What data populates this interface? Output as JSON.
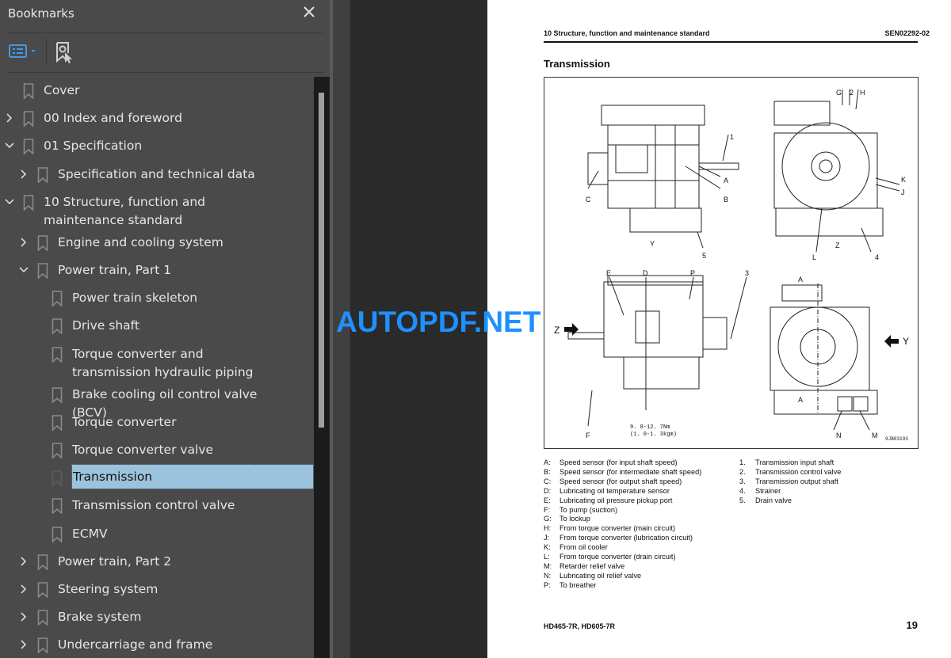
{
  "sidebar": {
    "title": "Bookmarks",
    "close_icon": "close-icon",
    "toolbar": {
      "options_icon": "bookmark-options-icon",
      "dropdown_icon": "caret-down-icon",
      "find_icon": "find-current-bookmark-icon"
    },
    "items": [
      {
        "label": "Cover",
        "level": 0,
        "expander": "none"
      },
      {
        "label": "00 Index and foreword",
        "level": 0,
        "expander": "collapsed"
      },
      {
        "label": "01 Specification",
        "level": 0,
        "expander": "expanded"
      },
      {
        "label": "Specification and technical data",
        "level": 1,
        "expander": "collapsed"
      },
      {
        "label": "10 Structure, function and maintenance standard",
        "level": 0,
        "expander": "expanded"
      },
      {
        "label": "Engine and cooling system",
        "level": 1,
        "expander": "collapsed"
      },
      {
        "label": "Power train, Part 1",
        "level": 1,
        "expander": "expanded"
      },
      {
        "label": "Power train skeleton",
        "level": 2,
        "expander": "none"
      },
      {
        "label": "Drive shaft",
        "level": 2,
        "expander": "none"
      },
      {
        "label": "Torque converter and transmission hydraulic piping",
        "level": 2,
        "expander": "none"
      },
      {
        "label": "Brake cooling oil control valve (BCV)",
        "level": 2,
        "expander": "none"
      },
      {
        "label": "Torque converter",
        "level": 2,
        "expander": "none"
      },
      {
        "label": "Torque converter valve",
        "level": 2,
        "expander": "none"
      },
      {
        "label": "Transmission",
        "level": 2,
        "expander": "none",
        "selected": true
      },
      {
        "label": "Transmission control valve",
        "level": 2,
        "expander": "none"
      },
      {
        "label": "ECMV",
        "level": 2,
        "expander": "none"
      },
      {
        "label": "Power train, Part 2",
        "level": 1,
        "expander": "collapsed"
      },
      {
        "label": "Steering system",
        "level": 1,
        "expander": "collapsed"
      },
      {
        "label": "Brake system",
        "level": 1,
        "expander": "collapsed"
      },
      {
        "label": "Undercarriage and frame",
        "level": 1,
        "expander": "collapsed"
      }
    ]
  },
  "watermark": "AUTOPDF.NET",
  "page": {
    "header_left": "10 Structure, function and maintenance standard",
    "header_right": "SEN02292-02",
    "title": "Transmission",
    "figure": {
      "callouts_top_left": [
        "1",
        "A",
        "B",
        "C",
        "5",
        "Y"
      ],
      "callouts_top_right": [
        "G",
        "2",
        "H",
        "K",
        "J",
        "L",
        "Z",
        "4"
      ],
      "callouts_bottom_left": [
        "E",
        "D",
        "P",
        "3",
        "Z",
        "F"
      ],
      "torque_note_line1": "9. 8-12. 7Nm",
      "torque_note_line2": "(1. 0-1. 3kgm)",
      "callouts_bottom_right": [
        "A",
        "A",
        "Y",
        "N",
        "M"
      ],
      "drawing_id": "9JB03193"
    },
    "legend_letters": [
      {
        "key": "A:",
        "text": "Speed sensor (for input shaft speed)"
      },
      {
        "key": "B:",
        "text": "Speed sensor (for intermediate shaft speed)"
      },
      {
        "key": "C:",
        "text": "Speed sensor (for output shaft speed)"
      },
      {
        "key": "D:",
        "text": "Lubricating oil temperature sensor"
      },
      {
        "key": "E:",
        "text": "Lubricating oil pressure pickup port"
      },
      {
        "key": "F:",
        "text": "To pump (suction)"
      },
      {
        "key": "G:",
        "text": "To lockup"
      },
      {
        "key": "H:",
        "text": "From torque converter (main circuit)"
      },
      {
        "key": "J:",
        "text": "From torque converter (lubrication circuit)"
      },
      {
        "key": "K:",
        "text": "From oil cooler"
      },
      {
        "key": "L:",
        "text": "From torque converter (drain circuit)"
      },
      {
        "key": "M:",
        "text": "Retarder relief valve"
      },
      {
        "key": "N:",
        "text": "Lubricating oil relief valve"
      },
      {
        "key": "P:",
        "text": "To breather"
      }
    ],
    "legend_numbers": [
      {
        "key": "1.",
        "text": "Transmission input shaft"
      },
      {
        "key": "2.",
        "text": "Transmission control valve"
      },
      {
        "key": "3.",
        "text": "Transmission output shaft"
      },
      {
        "key": "4.",
        "text": "Strainer"
      },
      {
        "key": "5.",
        "text": "Drain valve"
      }
    ],
    "footer_left": "HD465-7R, HD605-7R",
    "page_number": "19"
  },
  "colors": {
    "sidebar_bg": "#4a4a4a",
    "selection_bg": "#9cc3dd",
    "accent": "#3d9be9",
    "watermark": "#1e90ff",
    "doc_bg": "#2a2a2a"
  }
}
